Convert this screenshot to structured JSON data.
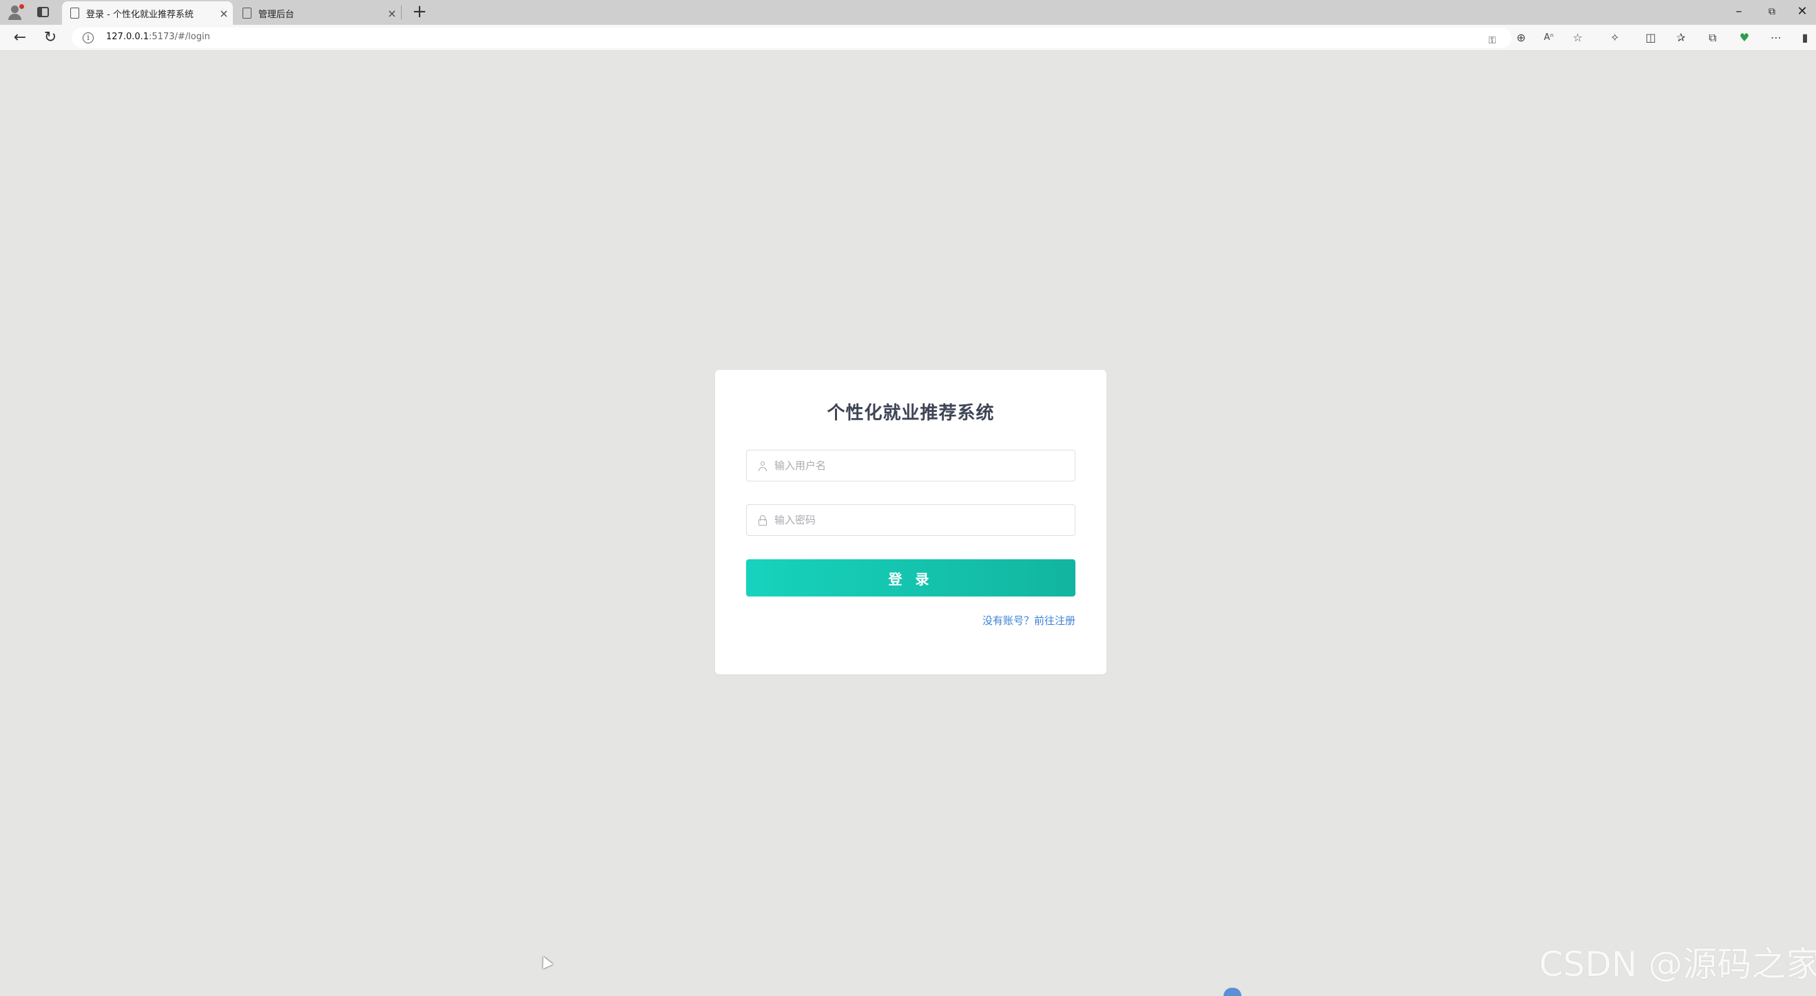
{
  "browser": {
    "tabs": [
      {
        "label": "登录 - 个性化就业推荐系统",
        "active": true
      },
      {
        "label": "管理后台",
        "active": false
      }
    ],
    "url_host": "127.0.0.1",
    "url_path": ":5173/#/login",
    "new_tab_glyph": "+",
    "close_glyph": "×",
    "icons": [
      "profile-icon",
      "workspaces-icon",
      "back-icon",
      "refresh-icon",
      "site-info-icon",
      "key-icon",
      "zoom-icon",
      "read-aloud-icon",
      "favorite-star-icon",
      "extensions-icon",
      "split-screen-icon",
      "favorites-icon",
      "collections-icon",
      "browser-essentials-icon",
      "more-icon",
      "sidebar-icon"
    ]
  },
  "login": {
    "title": "个性化就业推荐系统",
    "username_placeholder": "输入用户名",
    "password_placeholder": "输入密码",
    "submit_label": "登 录",
    "register_link": "没有账号？前往注册"
  },
  "watermark": "CSDN @源码之家",
  "colors": {
    "page_bg": "#e5e5e3",
    "button_gradient_start": "#17d3bd",
    "button_gradient_end": "#12b59f",
    "link": "#3b82d6",
    "title": "#3f4555"
  }
}
